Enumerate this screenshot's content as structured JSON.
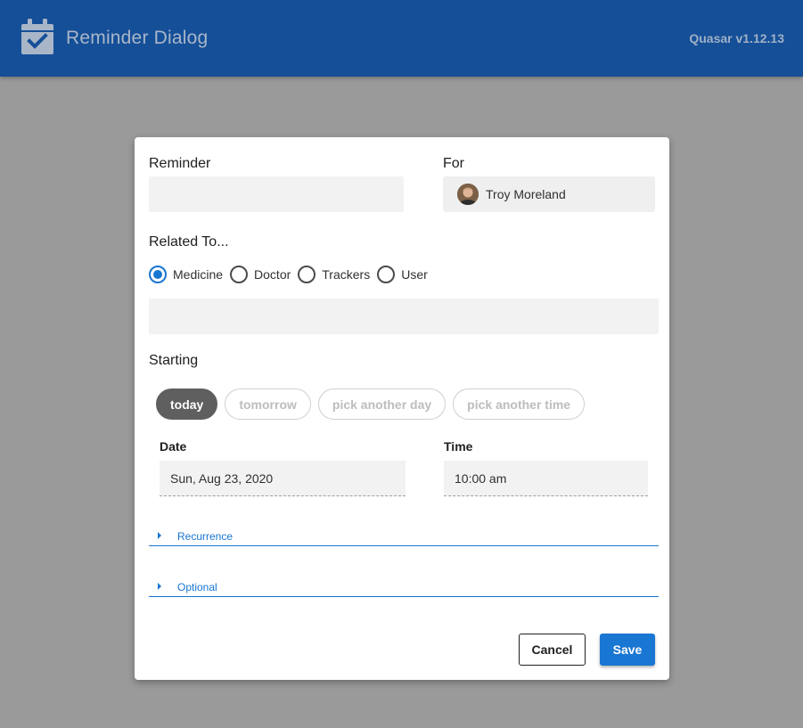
{
  "header": {
    "title": "Reminder Dialog",
    "version": "Quasar v1.12.13",
    "logo_icon": "calendar-check-icon",
    "bg_color": "#154f98"
  },
  "dialog": {
    "reminder_label": "Reminder",
    "reminder_value": "",
    "for_label": "For",
    "for_name": "Troy Moreland",
    "related_label": "Related To...",
    "related_options": [
      {
        "label": "Medicine",
        "checked": true
      },
      {
        "label": "Doctor",
        "checked": false
      },
      {
        "label": "Trackers",
        "checked": false
      },
      {
        "label": "User",
        "checked": false
      }
    ],
    "related_value": "",
    "starting_label": "Starting",
    "starting_chips": [
      {
        "label": "today",
        "active": true
      },
      {
        "label": "tomorrow",
        "active": false
      },
      {
        "label": "pick another day",
        "active": false
      },
      {
        "label": "pick another time",
        "active": false
      }
    ],
    "date_label": "Date",
    "date_value": "Sun, Aug 23, 2020",
    "time_label": "Time",
    "time_value": "10:00 am",
    "recurrence_label": "Recurrence",
    "optional_label": "Optional",
    "cancel_label": "Cancel",
    "save_label": "Save",
    "accent_color": "#1976d2"
  }
}
